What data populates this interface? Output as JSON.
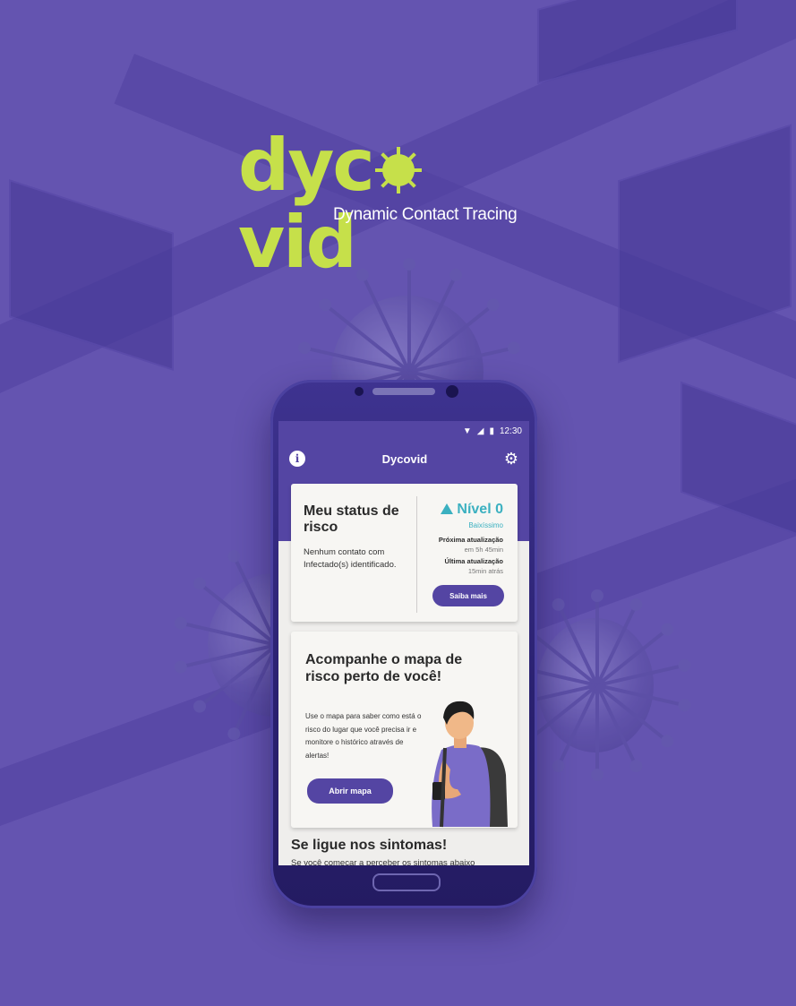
{
  "brand": {
    "logo_text_left": "dyc",
    "logo_text_right": "vid",
    "tagline": "Dynamic Contact Tracing"
  },
  "colors": {
    "background": "#6454b0",
    "brand_green": "#c6e04a",
    "app_purple": "#5445a3",
    "level_teal": "#3bb0c0"
  },
  "statusbar": {
    "time": "12:30",
    "icons": [
      "wifi-icon",
      "signal-icon",
      "battery-icon"
    ]
  },
  "appbar": {
    "title": "Dycovid",
    "info_icon": "i",
    "settings_icon": "⚙"
  },
  "risk_card": {
    "title": "Meu status de risco",
    "description": "Nenhum contato com Infectado(s) identificado.",
    "level": "Nível 0",
    "level_desc": "Baixíssimo",
    "next_update_label": "Próxima atualização",
    "next_update_value": "em 5h 45min",
    "last_update_label": "Última atualização",
    "last_update_value": "15min atrás",
    "button": "Saiba mais"
  },
  "map_card": {
    "title": "Acompanhe o mapa de risco perto de você!",
    "description": "Use o mapa para saber como está o risco do lugar que você precisa ir e monitore o histórico através de alertas!",
    "button": "Abrir mapa"
  },
  "symptoms": {
    "title": "Se ligue nos sintomas!",
    "text": "Se você começar a perceber os sintomas abaixo"
  }
}
